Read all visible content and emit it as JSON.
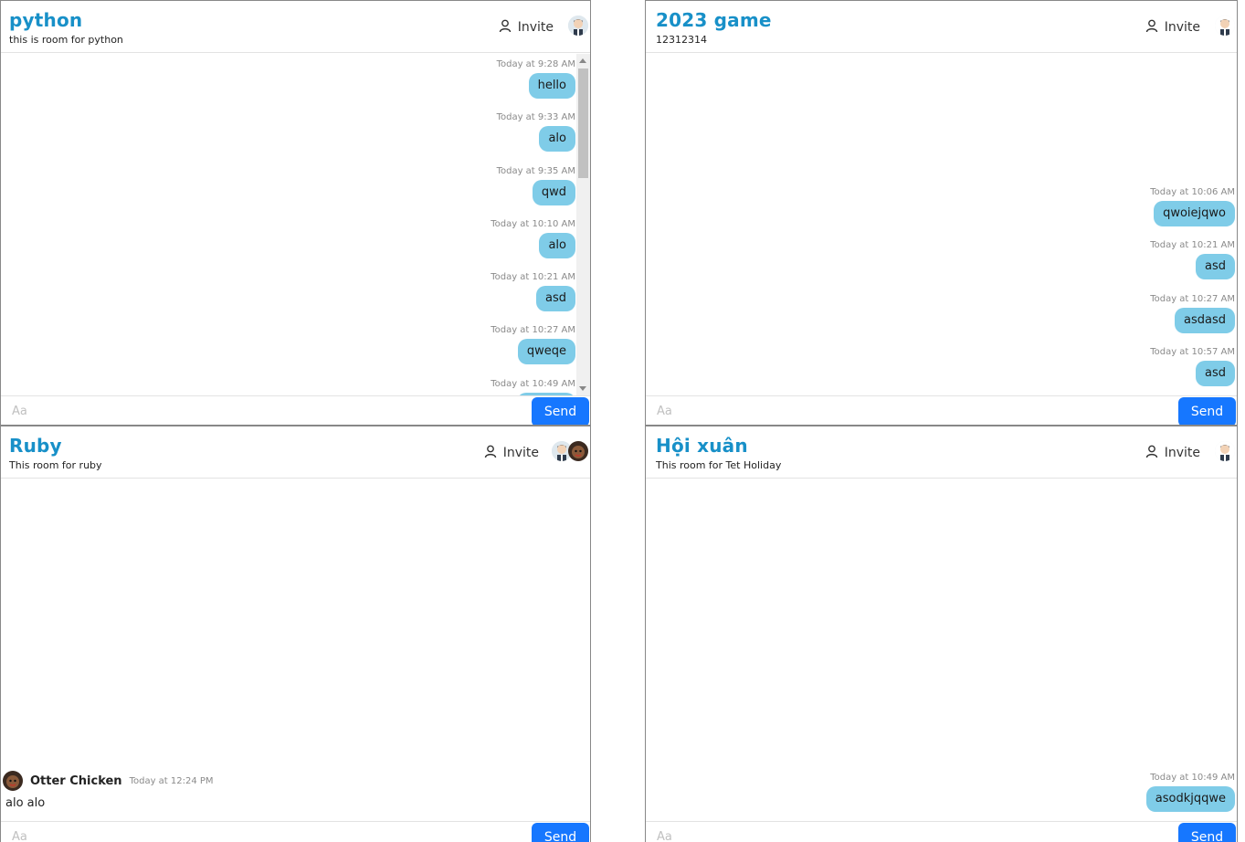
{
  "rooms": [
    {
      "title": "python",
      "description": "this is room for python",
      "invite_label": "Invite",
      "input_placeholder": "Aa",
      "send_label": "Send",
      "messages": [
        {
          "time": "Today at 9:28 AM",
          "text": "hello"
        },
        {
          "time": "Today at 9:33 AM",
          "text": "alo"
        },
        {
          "time": "Today at 9:35 AM",
          "text": "qwd"
        },
        {
          "time": "Today at 10:10 AM",
          "text": "alo"
        },
        {
          "time": "Today at 10:21 AM",
          "text": "asd"
        },
        {
          "time": "Today at 10:27 AM",
          "text": "qweqe"
        },
        {
          "time": "Today at 10:49 AM",
          "text": ""
        }
      ]
    },
    {
      "title": "2023 game",
      "description": "12312314",
      "invite_label": "Invite",
      "input_placeholder": "Aa",
      "send_label": "Send",
      "messages": [
        {
          "time": "Today at 10:06 AM",
          "text": "qwoiejqwo"
        },
        {
          "time": "Today at 10:21 AM",
          "text": "asd"
        },
        {
          "time": "Today at 10:27 AM",
          "text": "asdasd"
        },
        {
          "time": "Today at 10:57 AM",
          "text": "asd"
        }
      ]
    },
    {
      "title": "Ruby",
      "description": "This room for ruby",
      "invite_label": "Invite",
      "input_placeholder": "Aa",
      "send_label": "Send",
      "incoming": {
        "name": "Otter Chicken",
        "time": "Today at 12:24 PM",
        "text": "alo alo"
      }
    },
    {
      "title": "Hội xuân",
      "description": "This room for Tet Holiday",
      "invite_label": "Invite",
      "input_placeholder": "Aa",
      "send_label": "Send",
      "messages": [
        {
          "time": "Today at 10:49 AM",
          "text": "asodkjqqwe"
        }
      ]
    }
  ],
  "colors": {
    "title": "#1890c8",
    "bubble": "#7fcce8",
    "send_button": "#1677ff"
  },
  "icons": {
    "invite": "user-icon",
    "avatar_man": "man-avatar-icon",
    "avatar_otter": "otter-avatar-icon"
  }
}
